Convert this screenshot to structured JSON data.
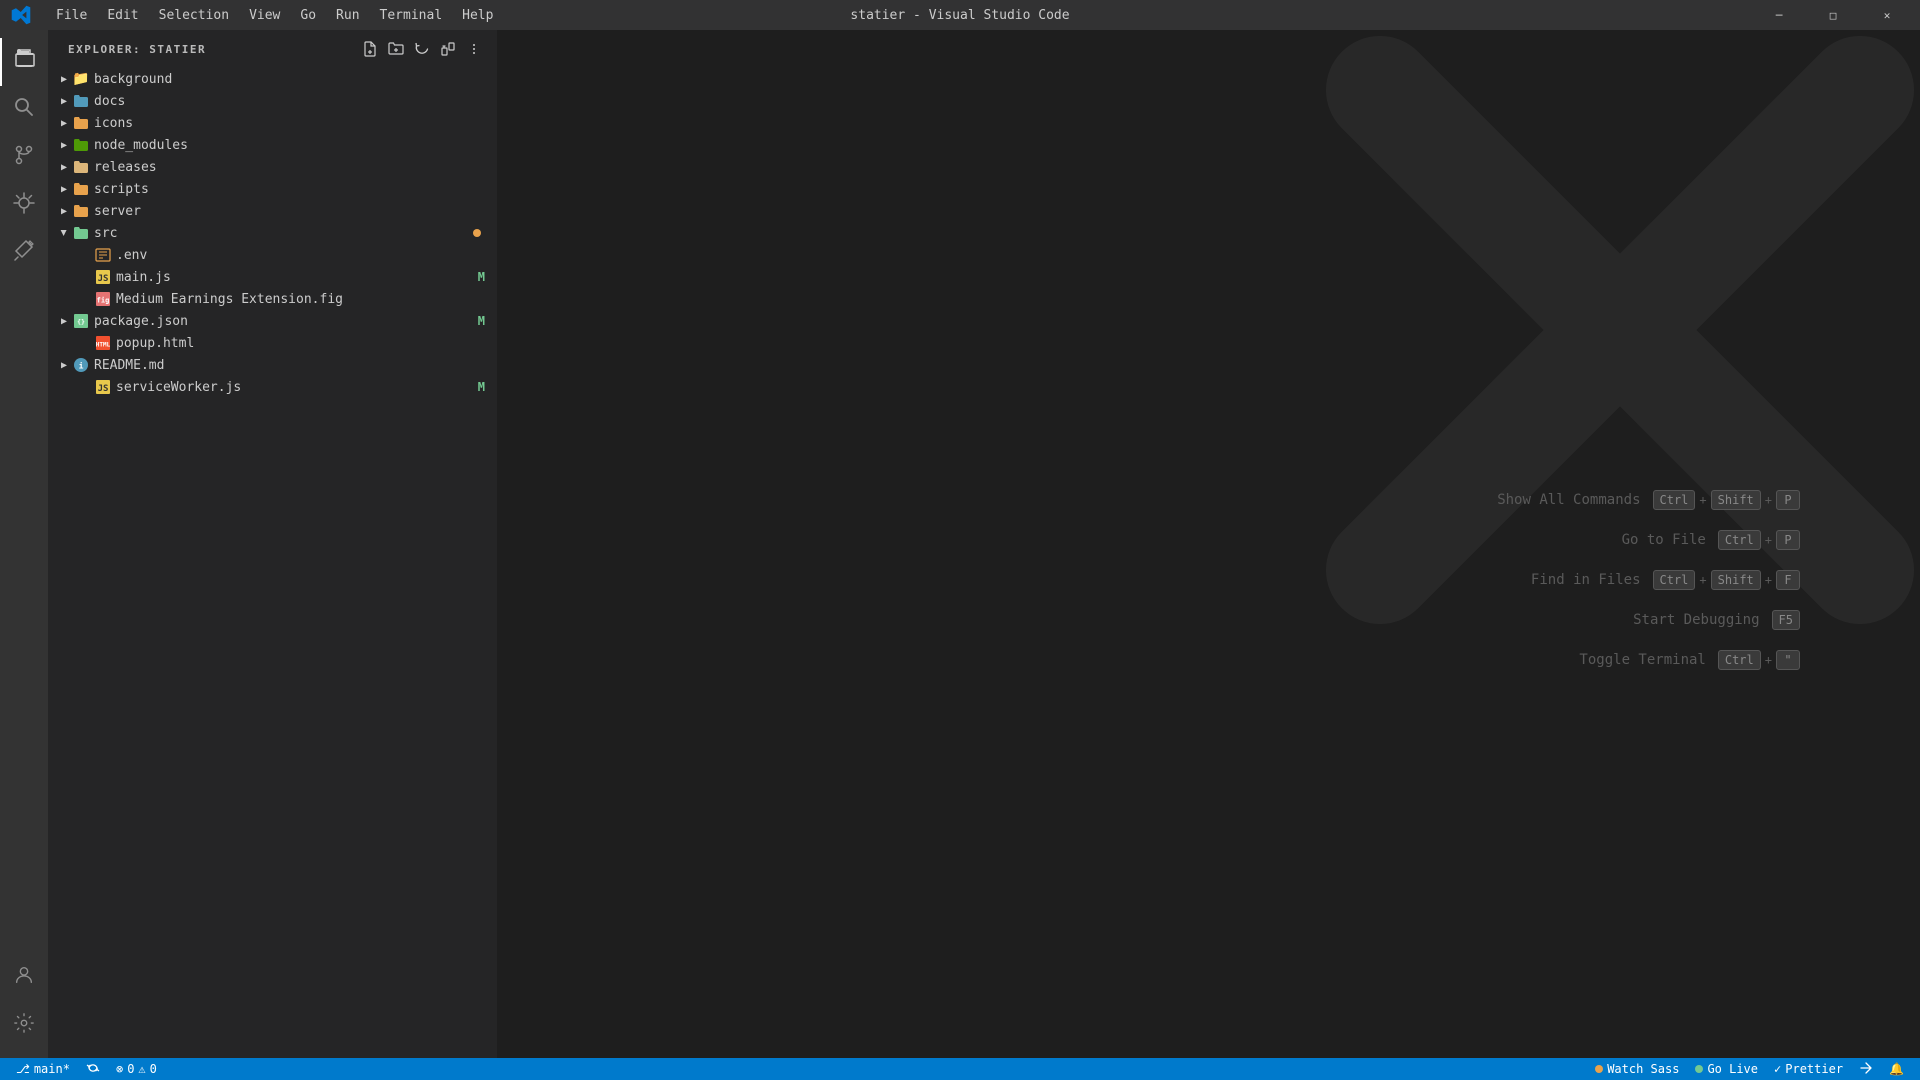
{
  "titlebar": {
    "title": "statier - Visual Studio Code",
    "menu": [
      "File",
      "Edit",
      "Selection",
      "View",
      "Go",
      "Run",
      "Terminal",
      "Help"
    ],
    "window_buttons": [
      "─",
      "□",
      "✕"
    ]
  },
  "activity_bar": {
    "items": [
      {
        "name": "explorer",
        "icon": "📄",
        "active": true
      },
      {
        "name": "search",
        "icon": "🔍"
      },
      {
        "name": "source-control",
        "icon": "⎇"
      },
      {
        "name": "run-debug",
        "icon": "🐛"
      },
      {
        "name": "extensions",
        "icon": "⊞"
      }
    ],
    "bottom_items": [
      {
        "name": "account",
        "icon": "👤"
      },
      {
        "name": "settings",
        "icon": "⚙"
      }
    ]
  },
  "sidebar": {
    "title": "EXPLORER: STATIER",
    "actions": [
      {
        "name": "new-file",
        "icon": "⊕"
      },
      {
        "name": "new-folder",
        "icon": "📁"
      },
      {
        "name": "refresh",
        "icon": "↺"
      },
      {
        "name": "collapse",
        "icon": "⊟"
      },
      {
        "name": "more",
        "icon": "···"
      }
    ],
    "tree": [
      {
        "type": "folder",
        "name": "background",
        "level": 0,
        "expanded": false,
        "color": "default",
        "badge": null
      },
      {
        "type": "folder",
        "name": "docs",
        "level": 0,
        "expanded": false,
        "color": "docs",
        "badge": null
      },
      {
        "type": "folder",
        "name": "icons",
        "level": 0,
        "expanded": false,
        "color": "icons",
        "badge": null
      },
      {
        "type": "folder",
        "name": "node_modules",
        "level": 0,
        "expanded": false,
        "color": "node",
        "badge": null
      },
      {
        "type": "folder",
        "name": "releases",
        "level": 0,
        "expanded": false,
        "color": "default",
        "badge": null
      },
      {
        "type": "folder",
        "name": "scripts",
        "level": 0,
        "expanded": false,
        "color": "scripts",
        "badge": null
      },
      {
        "type": "folder",
        "name": "server",
        "level": 0,
        "expanded": false,
        "color": "server",
        "badge": null
      },
      {
        "type": "folder",
        "name": "src",
        "level": 0,
        "expanded": true,
        "color": "src",
        "badge": "dot"
      },
      {
        "type": "file",
        "name": ".env",
        "level": 1,
        "color": "env",
        "badge": null,
        "icon_type": "hash"
      },
      {
        "type": "file",
        "name": "main.js",
        "level": 1,
        "color": "js",
        "badge": "M",
        "icon_type": "js"
      },
      {
        "type": "file",
        "name": "Medium Earnings Extension.fig",
        "level": 1,
        "color": "fig",
        "badge": null,
        "icon_type": "fig"
      },
      {
        "type": "folder",
        "name": "package.json",
        "level": 0,
        "expanded": false,
        "color": "json",
        "badge": "M",
        "icon_type": "json"
      },
      {
        "type": "file",
        "name": "popup.html",
        "level": 1,
        "color": "html",
        "badge": null,
        "icon_type": "html"
      },
      {
        "type": "folder",
        "name": "README.md",
        "level": 0,
        "expanded": false,
        "color": "md",
        "badge": null,
        "icon_type": "info"
      },
      {
        "type": "file",
        "name": "serviceWorker.js",
        "level": 1,
        "color": "js",
        "badge": "M",
        "icon_type": "js"
      }
    ]
  },
  "editor": {
    "shortcuts": [
      {
        "label": "Show All Commands",
        "keys": [
          "Ctrl",
          "+",
          "Shift",
          "+",
          "P"
        ]
      },
      {
        "label": "Go to File",
        "keys": [
          "Ctrl",
          "+",
          "P"
        ]
      },
      {
        "label": "Find in Files",
        "keys": [
          "Ctrl",
          "+",
          "Shift",
          "+",
          "F"
        ]
      },
      {
        "label": "Start Debugging",
        "keys": [
          "F5"
        ]
      },
      {
        "label": "Toggle Terminal",
        "keys": [
          "Ctrl",
          "+",
          "\""
        ]
      }
    ]
  },
  "statusbar": {
    "left_items": [
      {
        "icon": "⎇",
        "label": "main*"
      },
      {
        "icon": "↺",
        "label": ""
      },
      {
        "icon": "⊗",
        "label": "0"
      },
      {
        "icon": "⚠",
        "label": "0"
      }
    ],
    "right_items": [
      {
        "icon": "◉",
        "label": "Watch Sass"
      },
      {
        "icon": "◉",
        "label": "Go Live"
      },
      {
        "icon": "✓",
        "label": "Prettier"
      },
      {
        "icon": "⇄",
        "label": ""
      },
      {
        "icon": "🔔",
        "label": ""
      }
    ]
  }
}
